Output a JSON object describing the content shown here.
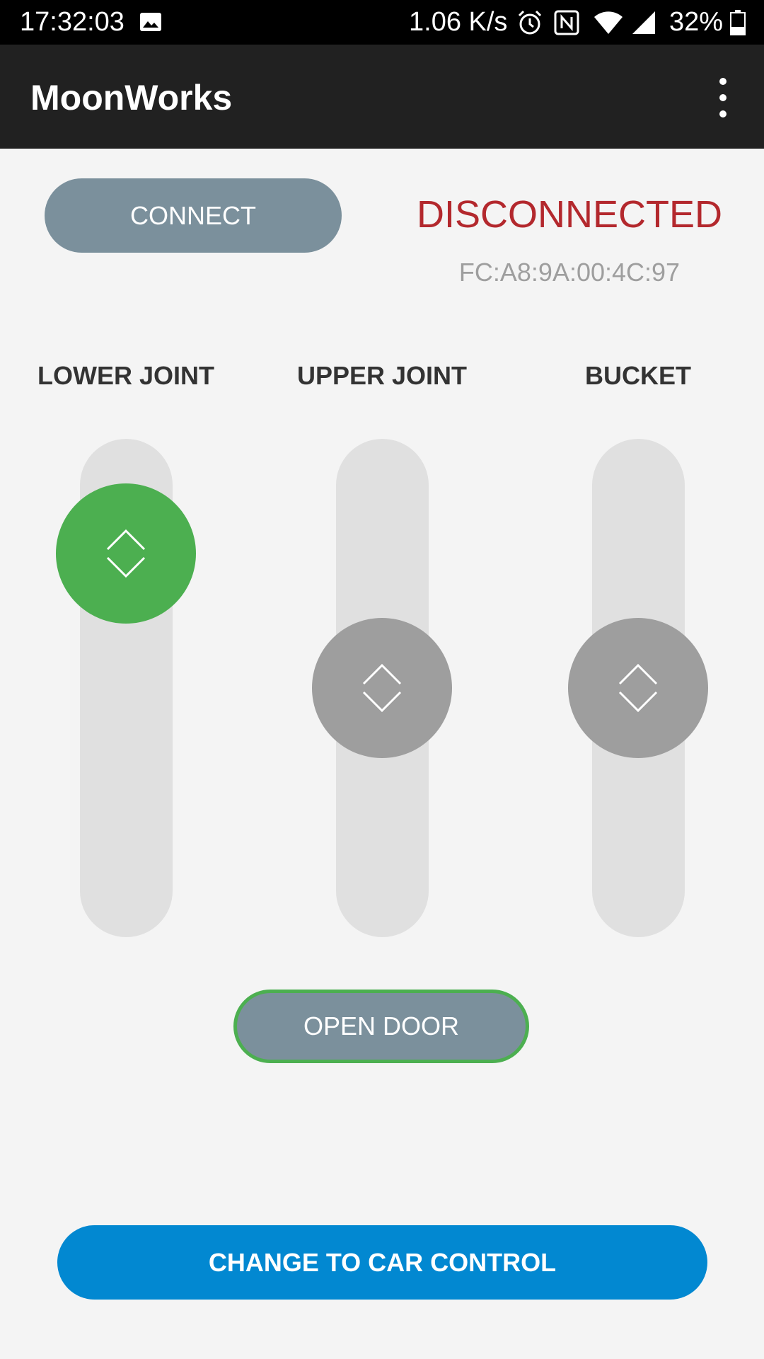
{
  "status_bar": {
    "time": "17:32:03",
    "net_speed": "1.06 K/s",
    "battery": "32%",
    "icons": [
      "image-icon",
      "alarm-icon",
      "nfc-icon",
      "wifi-icon",
      "signal-icon",
      "battery-icon"
    ]
  },
  "app_bar": {
    "title": "MoonWorks",
    "menu_icon": "overflow-menu-icon"
  },
  "connection": {
    "connect_label": "CONNECT",
    "status": "DISCONNECTED",
    "status_color": "#b3282d",
    "address": "FC:A8:9A:00:4C:97"
  },
  "joints": [
    {
      "label": "LOWER JOINT",
      "active": true
    },
    {
      "label": "UPPER JOINT",
      "active": false
    },
    {
      "label": "BUCKET",
      "active": false
    }
  ],
  "door": {
    "label": "OPEN DOOR"
  },
  "mode": {
    "label": "CHANGE TO CAR CONTROL"
  },
  "colors": {
    "accent_green": "#4caf50",
    "primary_blue": "#0288d1",
    "button_grey": "#7b909c",
    "appbar": "#212121"
  }
}
